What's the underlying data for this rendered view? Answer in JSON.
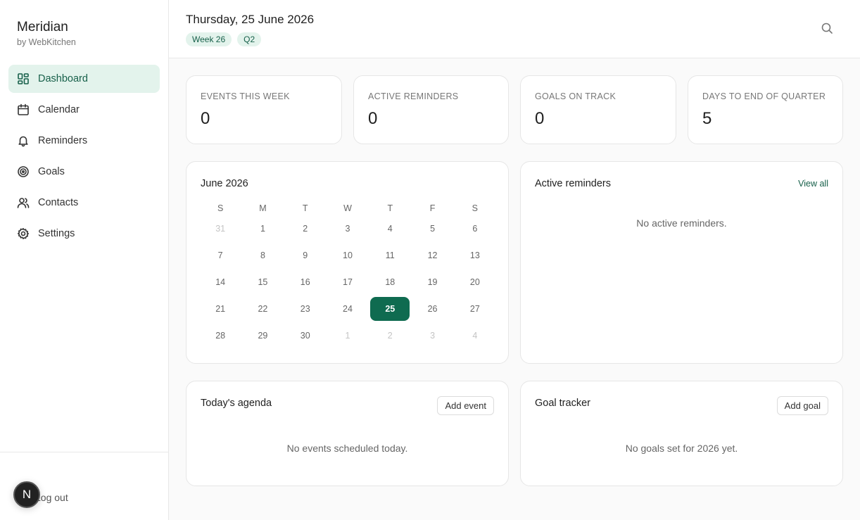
{
  "brand": {
    "name": "Meridian",
    "sub": "by WebKitchen"
  },
  "nav": [
    {
      "label": "Dashboard",
      "icon": "dashboard-icon",
      "active": true
    },
    {
      "label": "Calendar",
      "icon": "calendar-icon"
    },
    {
      "label": "Reminders",
      "icon": "bell-icon"
    },
    {
      "label": "Goals",
      "icon": "target-icon"
    },
    {
      "label": "Contacts",
      "icon": "users-icon"
    },
    {
      "label": "Settings",
      "icon": "gear-icon"
    }
  ],
  "footer": {
    "logout_label": "Log out",
    "avatar_initial": "N"
  },
  "header": {
    "date": "Thursday, 25 June 2026",
    "badges": [
      "Week 26",
      "Q2"
    ]
  },
  "stats": [
    {
      "label": "EVENTS THIS WEEK",
      "value": "0"
    },
    {
      "label": "ACTIVE REMINDERS",
      "value": "0"
    },
    {
      "label": "GOALS ON TRACK",
      "value": "0"
    },
    {
      "label": "DAYS TO END OF QUARTER",
      "value": "5"
    }
  ],
  "calendar": {
    "title": "June 2026",
    "weekdays": [
      "S",
      "M",
      "T",
      "W",
      "T",
      "F",
      "S"
    ],
    "weeks": [
      [
        "31",
        "1",
        "2",
        "3",
        "4",
        "5",
        "6"
      ],
      [
        "7",
        "8",
        "9",
        "10",
        "11",
        "12",
        "13"
      ],
      [
        "14",
        "15",
        "16",
        "17",
        "18",
        "19",
        "20"
      ],
      [
        "21",
        "22",
        "23",
        "24",
        "25",
        "26",
        "27"
      ],
      [
        "28",
        "29",
        "30",
        "1",
        "2",
        "3",
        "4"
      ]
    ],
    "today": "25"
  },
  "reminders": {
    "title": "Active reminders",
    "view_all": "View all",
    "empty": "No active reminders."
  },
  "agenda": {
    "title": "Today's agenda",
    "add_label": "Add event",
    "empty": "No events scheduled today."
  },
  "goals": {
    "title": "Goal tracker",
    "add_label": "Add goal",
    "empty": "No goals set for 2026 yet."
  },
  "colors": {
    "accent": "#0f6b50",
    "accent_soft": "#e3f3ec",
    "accent_text": "#17604a"
  }
}
